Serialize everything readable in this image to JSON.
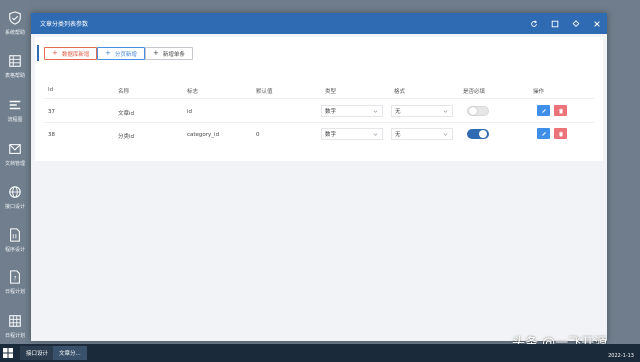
{
  "launcher": [
    {
      "label": "系统帮助",
      "icon": "shield-check-icon"
    },
    {
      "label": "表格帮助",
      "icon": "table-icon"
    },
    {
      "label": "流程图",
      "icon": "flow-icon"
    },
    {
      "label": "文档管理",
      "icon": "mail-icon"
    },
    {
      "label": "接口设计",
      "icon": "globe-icon"
    },
    {
      "label": "程序设计",
      "icon": "code-file-icon"
    },
    {
      "label": "日程计划",
      "icon": "help-file-icon"
    },
    {
      "label": "日程计划",
      "icon": "calendar-grid-icon"
    }
  ],
  "window": {
    "title": "文章分类列表参数",
    "controls": [
      "refresh-icon",
      "maximize-icon",
      "pin-icon",
      "close-icon"
    ]
  },
  "toolbar": {
    "btn_db_add": "数据库新增",
    "btn_page_add": "分页新增",
    "btn_single_add": "新增单条"
  },
  "table": {
    "columns": [
      "Id",
      "名称",
      "标志",
      "默认值",
      "类型",
      "格式",
      "是否必填",
      "操作"
    ],
    "rows": [
      {
        "id": "37",
        "name": "文章id",
        "flag": "id",
        "default": "",
        "type": "数字",
        "format": "无",
        "required": false
      },
      {
        "id": "38",
        "name": "分类id",
        "flag": "category_id",
        "default": "0",
        "type": "数字",
        "format": "无",
        "required": true
      }
    ]
  },
  "taskbar": {
    "tabs": [
      "接口设计",
      "文章分..."
    ],
    "date": "2022-1-13"
  },
  "watermark": "头条 @一飞开源",
  "colors": {
    "title_bar": "#2f6bb3",
    "edit_button": "#3f8ee8",
    "delete_button": "#ec7378",
    "toggle_on": "#2f6bb3"
  }
}
